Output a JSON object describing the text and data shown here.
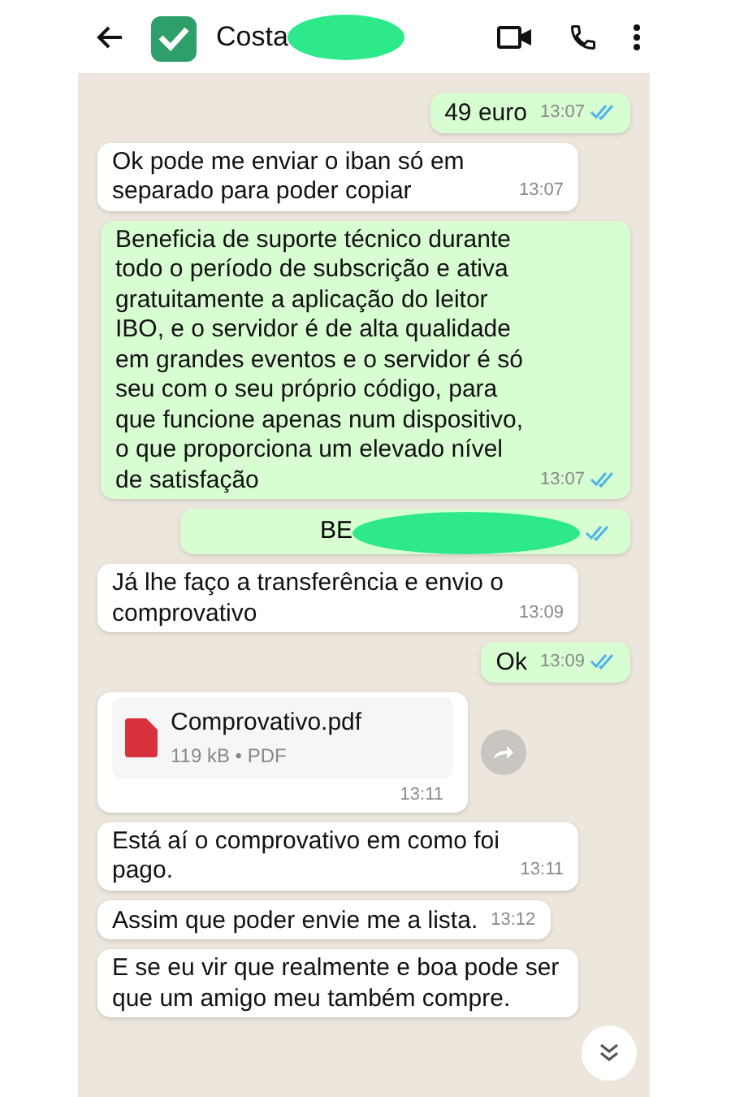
{
  "header": {
    "contact_name": "Costa"
  },
  "messages": [
    {
      "kind": "text",
      "sent": true,
      "text": "49 euro",
      "time": "13:07",
      "read": true
    },
    {
      "kind": "text",
      "sent": false,
      "text": "Ok pode me enviar o iban só em separado para poder copiar",
      "time": "13:07"
    },
    {
      "kind": "text",
      "sent": true,
      "text": "Beneficia de suporte técnico durante todo o período de subscrição e ativa gratuitamente a aplicação do leitor IBO, e o servidor é de alta qualidade em grandes eventos e o servidor é só seu com o seu próprio código, para que funcione apenas num dispositivo, o que proporciona um elevado nível de satisfação",
      "time": "13:07",
      "read": true
    },
    {
      "kind": "redacted",
      "sent": true,
      "text": "BE",
      "read": true
    },
    {
      "kind": "text",
      "sent": false,
      "text": "Já lhe faço a transferência e envio o comprovativo",
      "time": "13:09"
    },
    {
      "kind": "text",
      "sent": true,
      "text": "Ok",
      "time": "13:09",
      "read": true
    },
    {
      "kind": "file",
      "sent": false,
      "file_name": "Comprovativo.pdf",
      "file_meta": "119 kB • PDF",
      "time": "13:11"
    },
    {
      "kind": "text",
      "sent": false,
      "text": "Está aí o comprovativo em como foi pago.",
      "time": "13:11"
    },
    {
      "kind": "text",
      "sent": false,
      "text": "Assim que poder envie me a lista.",
      "time": "13:12"
    },
    {
      "kind": "text",
      "sent": false,
      "text": "E se eu vir que realmente e boa pode ser que um amigo meu também compre."
    }
  ]
}
